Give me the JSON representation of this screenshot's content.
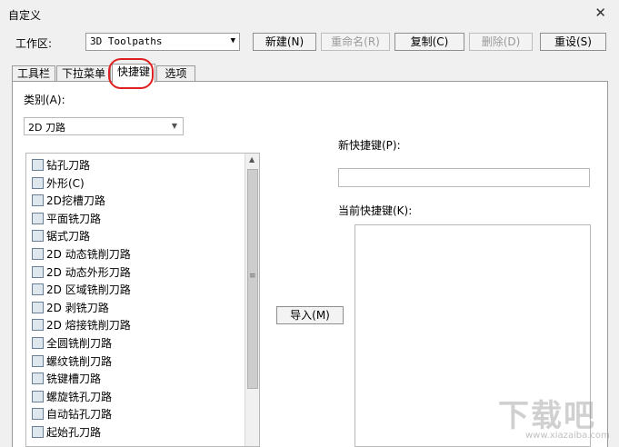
{
  "window": {
    "title": "自定义",
    "close_glyph": "✕"
  },
  "workspace": {
    "label": "工作区:",
    "value": "3D Toolpaths"
  },
  "buttons": {
    "new": "新建(N)",
    "rename": "重命名(R)",
    "copy": "复制(C)",
    "delete": "删除(D)",
    "reset": "重设(S)"
  },
  "tabs": [
    "工具栏",
    "下拉菜单",
    "快捷键",
    "选项"
  ],
  "active_tab": "快捷键",
  "category": {
    "label": "类别(A):",
    "value": "2D 刀路"
  },
  "commands": [
    "钻孔刀路",
    "外形(C)",
    "2D挖槽刀路",
    "平面铣刀路",
    "锯式刀路",
    "2D 动态铣削刀路",
    "2D 动态外形刀路",
    "2D 区域铣削刀路",
    "2D 剥铣刀路",
    "2D 熔接铣削刀路",
    "全圆铣削刀路",
    "螺纹铣削刀路",
    "铣键槽刀路",
    "螺旋铣孔刀路",
    "自动钻孔刀路",
    "起始孔刀路"
  ],
  "import_button": "导入(M)",
  "new_shortcut": {
    "label": "新快捷键(P):",
    "value": ""
  },
  "current_shortcut": {
    "label": "当前快捷键(K):"
  },
  "watermark": {
    "text": "下载吧",
    "url": "www.xiazaiba.com"
  },
  "colors": {
    "highlight": "#e02020",
    "panel_bg": "#ffffff",
    "window_bg": "#f0f0f0"
  },
  "icons": {
    "close": "close-icon",
    "dropdown": "chevron-down-icon",
    "scroll_up": "chevron-up-icon",
    "command": "toolpath-icon"
  }
}
